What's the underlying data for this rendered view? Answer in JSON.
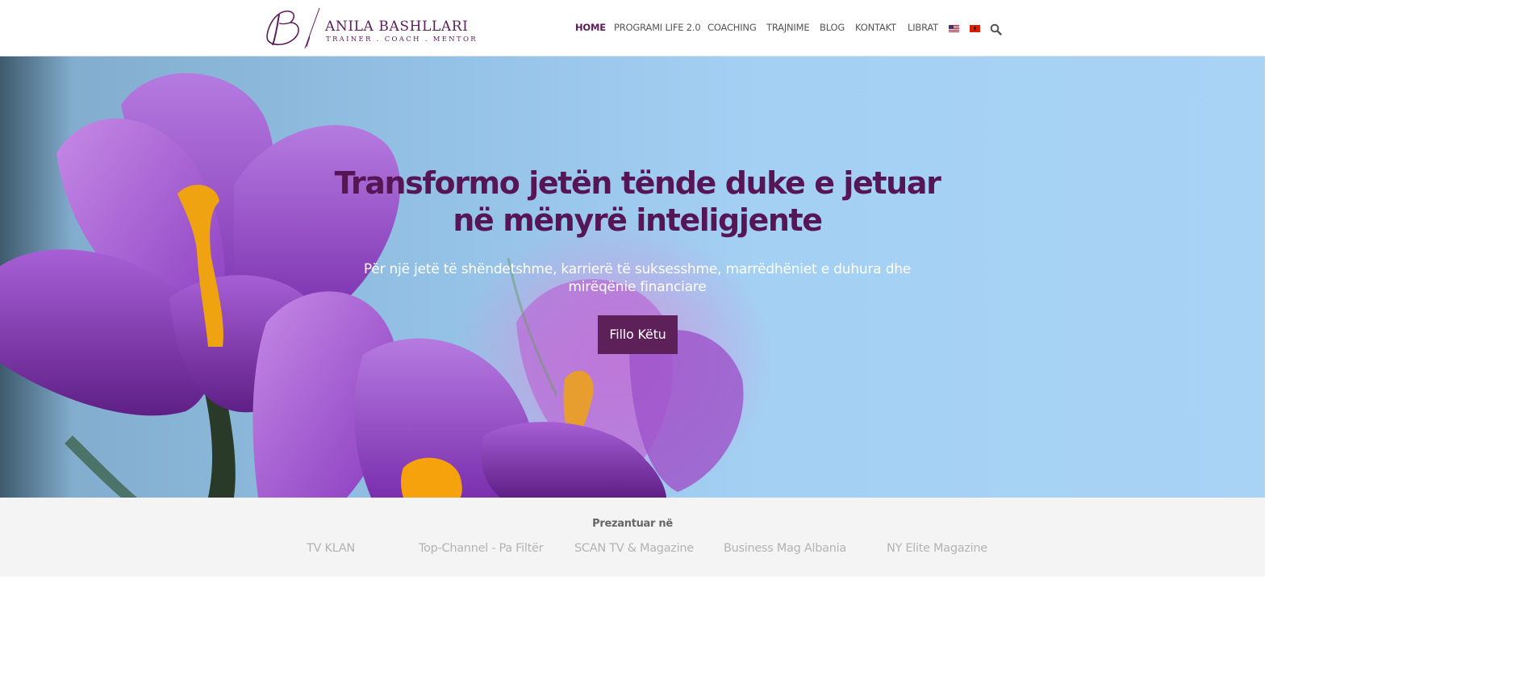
{
  "brand": {
    "name": "ANILA BASHLLARI",
    "tagline": "TRAINER . COACH . MENTOR",
    "color": "#5b1d5a"
  },
  "nav": {
    "items": [
      {
        "label": "HOME",
        "active": true
      },
      {
        "label": "PROGRAMI LIFE 2.0"
      },
      {
        "label": "COACHING"
      },
      {
        "label": "TRAJNIME"
      },
      {
        "label": "BLOG"
      },
      {
        "label": "KONTAKT"
      },
      {
        "label": "LIBRAT"
      }
    ],
    "flags": [
      "us-flag-icon",
      "albania-flag-icon"
    ],
    "search_icon": "search-icon"
  },
  "hero": {
    "title": "Transformo jetën tënde duke e jetuar në mënyrë inteligjente",
    "subtitle": "Për një jetë të shëndetshme, karrierë të suksesshme, marrëdhëniet e duhura dhe mirëqënie financiare",
    "cta_label": "Fillo Këtu",
    "accent": "#561655",
    "button_color": "#5d2058"
  },
  "featured": {
    "title": "Prezantuar në",
    "outlets": [
      "TV KLAN",
      "Top-Channel - Pa Filtër",
      "SCAN TV & Magazine",
      "Business Mag Albania",
      "NY Elite Magazine"
    ]
  }
}
